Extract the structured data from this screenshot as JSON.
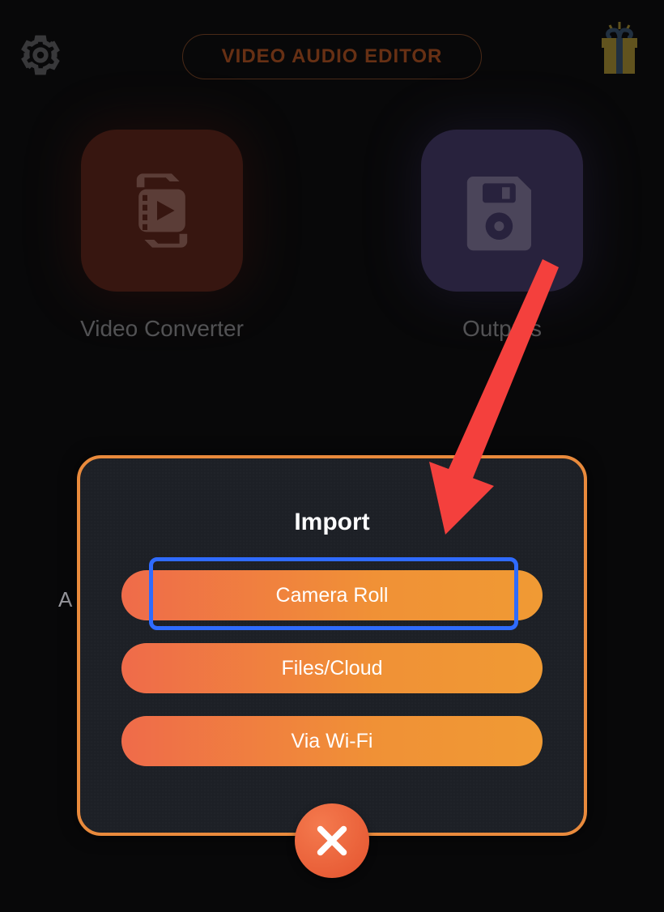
{
  "header": {
    "title": "VIDEO AUDIO EDITOR"
  },
  "tiles": {
    "converter_label": "Video Converter",
    "outputs_label": "Outputs"
  },
  "hidden_left_text": "A",
  "dialog": {
    "title": "Import",
    "options": {
      "camera_roll": "Camera Roll",
      "files_cloud": "Files/Cloud",
      "via_wifi": "Via Wi-Fi"
    }
  },
  "annotation": {
    "arrow_color": "#f4403d",
    "highlight_color": "#2f6bff"
  }
}
